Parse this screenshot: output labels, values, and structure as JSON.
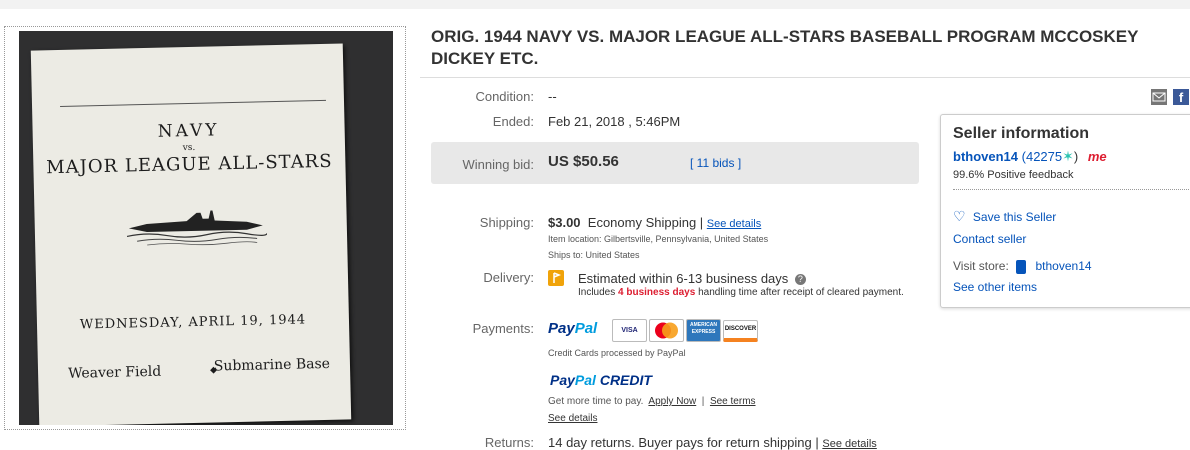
{
  "listing": {
    "title": "ORIG. 1944 NAVY VS. MAJOR LEAGUE ALL-STARS BASEBALL PROGRAM MCCOSKEY DICKEY ETC."
  },
  "program_image": {
    "line1": "NAVY",
    "line2": "vs.",
    "line3": "MAJOR LEAGUE ALL-STARS",
    "date": "WEDNESDAY, APRIL 19, 1944",
    "left": "Weaver Field",
    "right": "Submarine Base"
  },
  "condition": {
    "label": "Condition:",
    "value": "--"
  },
  "ended": {
    "label": "Ended:",
    "value": "Feb 21, 2018 , 5:46PM"
  },
  "winning_bid": {
    "label": "Winning bid:",
    "price": "US $50.56",
    "bids": "[ 11 bids ]",
    "bids_link": "11 bids"
  },
  "shipping": {
    "label": "Shipping:",
    "price": "$3.00",
    "method": "Economy Shipping |",
    "see_details": "See details",
    "location": "Item location:  Gilbertsville, Pennsylvania, United States",
    "ships_to": "Ships to:  United States"
  },
  "delivery": {
    "label": "Delivery:",
    "estimate": "Estimated within 6-13 business days",
    "note_pre": "Includes ",
    "note_bold": "4 business days",
    "note_post": " handling time after receipt of cleared payment."
  },
  "payments": {
    "label": "Payments:",
    "paypal": "PayPal",
    "cards": [
      "VISA",
      "MasterCard",
      "AMERICAN EXPRESS",
      "DISCOVER"
    ],
    "cc_note": "Credit Cards processed by PayPal",
    "paypal_credit": "PayPal CREDIT",
    "credit_text": "Get more time to pay.",
    "apply_now": "Apply Now",
    "see_terms": "See terms",
    "see_details": "See details"
  },
  "returns": {
    "label": "Returns:",
    "text": "14 day returns. Buyer pays for return shipping |",
    "see_details": "See details"
  },
  "seller": {
    "header": "Seller information",
    "name": "bthoven14",
    "feedback_count": "(42275",
    "feedback_close": ")",
    "me_badge": "me",
    "positive": "99.6% Positive feedback",
    "save": "Save this Seller",
    "contact": "Contact seller",
    "visit_label": "Visit store:",
    "store_name": "bthoven14",
    "see_other": "See other items"
  },
  "share": {
    "facebook": "f"
  },
  "colors": {
    "link": "#0654ba",
    "bidbox": "#e8e8e8",
    "delivery_flag": "#f0a30a",
    "paypal_dark": "#003087",
    "paypal_light": "#009cde"
  },
  "icons": [
    "mail-icon",
    "facebook-icon",
    "star-icon",
    "heart-icon",
    "store-icon",
    "delivery-flag-icon",
    "help-icon"
  ]
}
